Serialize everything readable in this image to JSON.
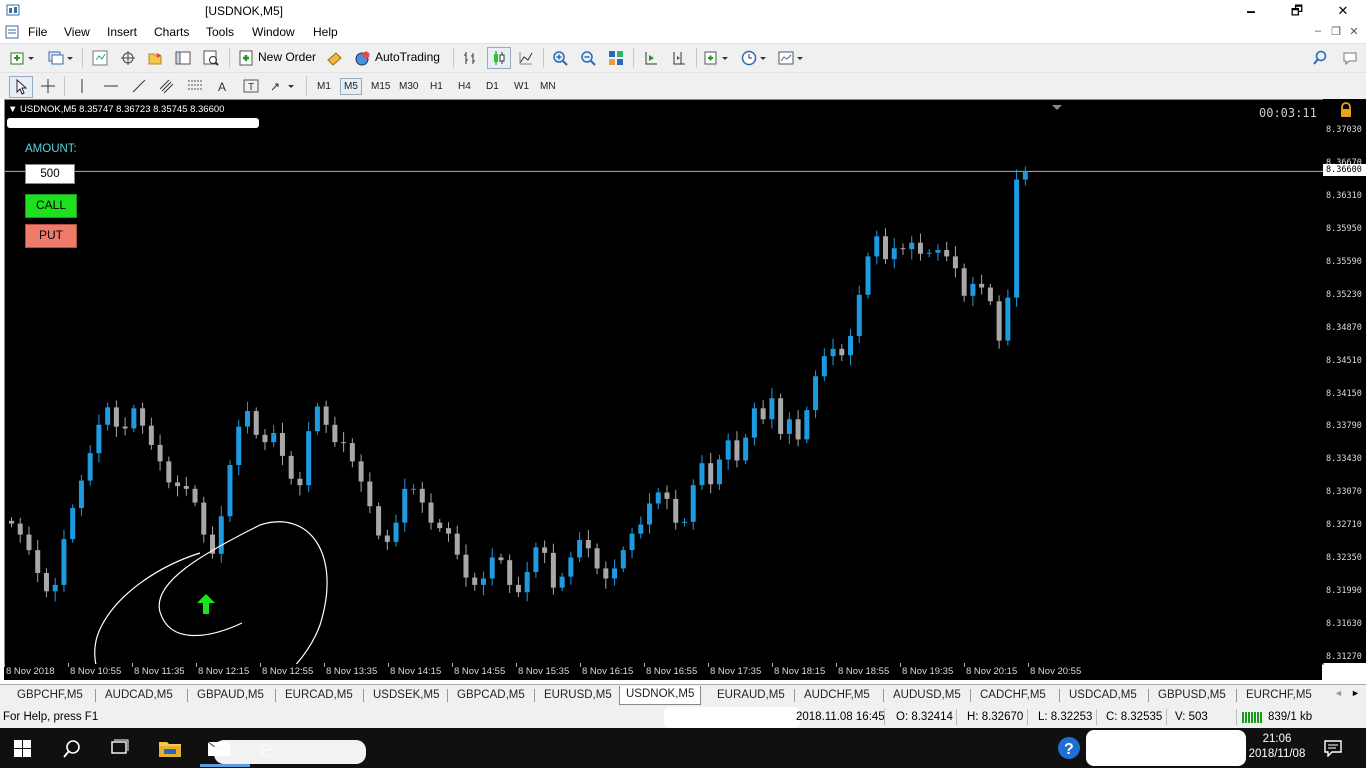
{
  "window": {
    "title": "[USDNOK,M5]",
    "minimize_glyph": "🗕",
    "maximize_glyph": "🗗",
    "close_glyph": "✕"
  },
  "menu": [
    "File",
    "View",
    "Insert",
    "Charts",
    "Tools",
    "Window",
    "Help"
  ],
  "toolbar": {
    "new_order": "New Order",
    "autotrading": "AutoTrading"
  },
  "timeframes": [
    "M1",
    "M5",
    "M15",
    "M30",
    "H1",
    "H4",
    "D1",
    "W1",
    "MN"
  ],
  "active_timeframe": "M5",
  "chart": {
    "header": "USDNOK,M5  8.35747 8.36723 8.35745 8.36600",
    "countdown": "00:03:11",
    "current_price": "8.36600",
    "colors": {
      "bull": "#1e9ae0",
      "bear": "#a8a8a8",
      "background": "#000000",
      "price_line": "#9bb6c8"
    }
  },
  "panel": {
    "amount_label": "AMOUNT:",
    "amount_value": "500",
    "call_label": "CALL",
    "put_label": "PUT"
  },
  "chart_data": {
    "type": "candlestick",
    "symbol": "USDNOK",
    "timeframe": "M5",
    "y_ticks": [
      "8.37030",
      "8.36670",
      "8.36310",
      "8.35950",
      "8.35590",
      "8.35230",
      "8.34870",
      "8.34510",
      "8.34150",
      "8.33790",
      "8.33430",
      "8.33070",
      "8.32710",
      "8.32350",
      "8.31990",
      "8.31630",
      "8.31270"
    ],
    "x_ticks": [
      "8 Nov 2018",
      "8 Nov 10:55",
      "8 Nov 11:35",
      "8 Nov 12:15",
      "8 Nov 12:55",
      "8 Nov 13:35",
      "8 Nov 14:15",
      "8 Nov 14:55",
      "8 Nov 15:35",
      "8 Nov 16:15",
      "8 Nov 16:55",
      "8 Nov 17:35",
      "8 Nov 18:15",
      "8 Nov 18:55",
      "8 Nov 19:35",
      "8 Nov 20:15",
      "8 Nov 20:55"
    ],
    "ylim": [
      8.3127,
      8.3721
    ],
    "close_series": [
      8.3275,
      8.3263,
      8.3246,
      8.3221,
      8.3201,
      8.3208,
      8.3258,
      8.3292,
      8.3322,
      8.3352,
      8.3383,
      8.3402,
      8.3381,
      8.3379,
      8.3401,
      8.3382,
      8.3361,
      8.3343,
      8.332,
      8.3316,
      8.3313,
      8.3298,
      8.3263,
      8.3242,
      8.3283,
      8.3339,
      8.3381,
      8.3398,
      8.3372,
      8.3364,
      8.3374,
      8.3349,
      8.3324,
      8.3317,
      8.3376,
      8.3403,
      8.3383,
      8.3364,
      8.3363,
      8.3343,
      8.3321,
      8.3294,
      8.3262,
      8.3255,
      8.3276,
      8.3313,
      8.3313,
      8.3298,
      8.3276,
      8.327,
      8.3264,
      8.3241,
      8.3216,
      8.3208,
      8.3215,
      8.3238,
      8.3235,
      8.3208,
      8.32,
      8.3222,
      8.3249,
      8.3243,
      8.3205,
      8.3217,
      8.3238,
      8.3257,
      8.3248,
      8.3226,
      8.3215,
      8.3226,
      8.3246,
      8.3264,
      8.3274,
      8.3297,
      8.3309,
      8.3302,
      8.3276,
      8.3277,
      8.3317,
      8.3341,
      8.3318,
      8.3345,
      8.3366,
      8.3344,
      8.3369,
      8.3401,
      8.3389,
      8.3412,
      8.3373,
      8.3389,
      8.3367,
      8.3399,
      8.3436,
      8.3458,
      8.3466,
      8.3459,
      8.348,
      8.3525,
      8.3567,
      8.3589,
      8.3564,
      8.3576,
      8.3575,
      8.3582,
      8.357,
      8.3571,
      8.3574,
      8.3567,
      8.3554,
      8.3524,
      8.3537,
      8.3533,
      8.3518,
      8.3475,
      8.3522,
      8.3651,
      8.366
    ],
    "current_price": 8.366
  },
  "tabs": [
    "GBPCHF,M5",
    "AUDCAD,M5",
    "GBPAUD,M5",
    "EURCAD,M5",
    "USDSEK,M5",
    "GBPCAD,M5",
    "EURUSD,M5",
    "USDNOK,M5",
    "EURAUD,M5",
    "AUDCHF,M5",
    "AUDUSD,M5",
    "CADCHF,M5",
    "USDCAD,M5",
    "GBPUSD,M5",
    "EURCHF,M5"
  ],
  "active_tab": "USDNOK,M5",
  "tab_scroll": {
    "left": "◄",
    "right": "►"
  },
  "status": {
    "help": "For Help, press F1",
    "datetime": "2018.11.08 16:45",
    "open": "O: 8.32414",
    "high": "H: 8.32670",
    "low": "L: 8.32253",
    "close": "C: 8.32535",
    "volume": "V: 503",
    "traffic": "839/1 kb"
  },
  "taskbar": {
    "time": "21:06",
    "date": "2018/11/08"
  }
}
